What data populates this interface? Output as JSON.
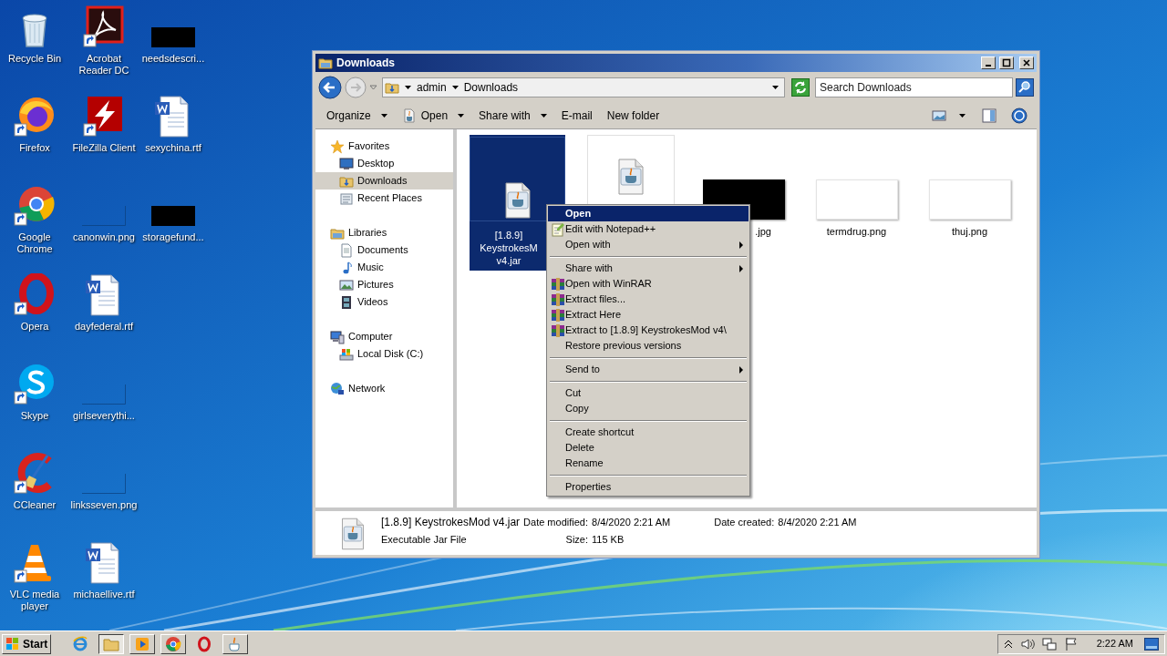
{
  "desktop": {
    "columns": [
      [
        {
          "label": "Recycle Bin",
          "kind": "recycle",
          "shortcut": false
        },
        {
          "label": "Firefox",
          "kind": "firefox",
          "shortcut": true
        },
        {
          "label": "Google Chrome",
          "kind": "chrome",
          "shortcut": true
        },
        {
          "label": "Opera",
          "kind": "opera",
          "shortcut": true
        },
        {
          "label": "Skype",
          "kind": "skype",
          "shortcut": true
        },
        {
          "label": "CCleaner",
          "kind": "ccleaner",
          "shortcut": true
        },
        {
          "label": "VLC media player",
          "kind": "vlc",
          "shortcut": true
        }
      ],
      [
        {
          "label": "Acrobat Reader DC",
          "kind": "acrobat",
          "shortcut": true
        },
        {
          "label": "FileZilla Client",
          "kind": "filezilla",
          "shortcut": true
        },
        {
          "label": "canonwin.png",
          "kind": "blank",
          "shortcut": false
        },
        {
          "label": "dayfederal.rtf",
          "kind": "word",
          "shortcut": false
        },
        {
          "label": "girlseverythi...",
          "kind": "blank",
          "shortcut": false
        },
        {
          "label": "linksseven.png",
          "kind": "blank",
          "shortcut": false
        },
        {
          "label": "michaellive.rtf",
          "kind": "word",
          "shortcut": false
        }
      ],
      [
        {
          "label": "needsdescri...",
          "kind": "black",
          "shortcut": false
        },
        {
          "label": "sexychina.rtf",
          "kind": "word",
          "shortcut": false
        },
        {
          "label": "storagefund...",
          "kind": "black",
          "shortcut": false
        }
      ]
    ]
  },
  "window": {
    "title": "Downloads",
    "breadcrumb": [
      "admin",
      "Downloads"
    ],
    "search": {
      "placeholder": "Search Downloads"
    },
    "toolbar": [
      {
        "label": "Organize",
        "dropdown": true,
        "kind": "plain"
      },
      {
        "label": "Open",
        "dropdown": true,
        "kind": "app"
      },
      {
        "label": "Share with",
        "dropdown": true,
        "kind": "plain"
      },
      {
        "label": "E-mail",
        "dropdown": false,
        "kind": "plain"
      },
      {
        "label": "New folder",
        "dropdown": false,
        "kind": "plain"
      }
    ],
    "nav": [
      {
        "label": "Favorites",
        "kind": "star",
        "selected": false,
        "children": [
          {
            "label": "Desktop",
            "kind": "desktop",
            "selected": false
          },
          {
            "label": "Downloads",
            "kind": "downloads",
            "selected": true
          },
          {
            "label": "Recent Places",
            "kind": "recent",
            "selected": false
          }
        ]
      },
      {
        "label": "Libraries",
        "kind": "libraries",
        "selected": false,
        "children": [
          {
            "label": "Documents",
            "kind": "documents",
            "selected": false
          },
          {
            "label": "Music",
            "kind": "music",
            "selected": false
          },
          {
            "label": "Pictures",
            "kind": "pictures",
            "selected": false
          },
          {
            "label": "Videos",
            "kind": "videos",
            "selected": false
          }
        ]
      },
      {
        "label": "Computer",
        "kind": "computer",
        "selected": false,
        "children": [
          {
            "label": "Local Disk (C:)",
            "kind": "disk",
            "selected": false
          }
        ]
      },
      {
        "label": "Network",
        "kind": "network",
        "selected": false
      }
    ],
    "files": [
      {
        "label": "[1.8.9] KeystrokesM v4.jar",
        "kind": "jar",
        "selected": true,
        "clipped_right": true,
        "clipped_left": false
      },
      {
        "kind": "jar_framed",
        "selected": false
      },
      {
        "label": ".jpg",
        "kind": "black",
        "selected": false,
        "clipped_right": false,
        "clipped_left": true
      },
      {
        "label": "termdrug.png",
        "kind": "white",
        "selected": false,
        "clipped_right": false,
        "clipped_left": false
      },
      {
        "label": "thuj.png",
        "kind": "white",
        "selected": false,
        "clipped_right": false,
        "clipped_left": false
      }
    ],
    "details": {
      "name": "[1.8.9] KeystrokesMod v4.jar",
      "type": "Executable Jar File",
      "properties": [
        {
          "label": "Date modified:",
          "value": "8/4/2020 2:21 AM"
        },
        {
          "label": "Date created:",
          "value": "8/4/2020 2:21 AM"
        },
        {
          "label": "Size:",
          "value": "115 KB"
        }
      ]
    }
  },
  "context_menu": [
    {
      "kind": "item",
      "label": "Open",
      "default": true,
      "selected": true,
      "submenu": false
    },
    {
      "kind": "notepad_item",
      "label": "Edit with Notepad++",
      "default": false,
      "selected": false,
      "submenu": false
    },
    {
      "kind": "item",
      "label": "Open with",
      "default": false,
      "selected": false,
      "submenu": true
    },
    {
      "kind": "separator"
    },
    {
      "kind": "item",
      "label": "Share with",
      "default": false,
      "selected": false,
      "submenu": true
    },
    {
      "kind": "archive_item",
      "label": "Open with WinRAR",
      "default": false,
      "selected": false,
      "submenu": false
    },
    {
      "kind": "archive_item",
      "label": "Extract files...",
      "default": false,
      "selected": false,
      "submenu": false
    },
    {
      "kind": "archive_item",
      "label": "Extract Here",
      "default": false,
      "selected": false,
      "submenu": false
    },
    {
      "kind": "archive_item",
      "label": "Extract to [1.8.9] KeystrokesMod v4\\",
      "default": false,
      "selected": false,
      "submenu": false
    },
    {
      "kind": "item",
      "label": "Restore previous versions",
      "default": false,
      "selected": false,
      "submenu": false
    },
    {
      "kind": "separator"
    },
    {
      "kind": "item",
      "label": "Send to",
      "default": false,
      "selected": false,
      "submenu": true
    },
    {
      "kind": "separator"
    },
    {
      "kind": "item",
      "label": "Cut",
      "default": false,
      "selected": false,
      "submenu": false
    },
    {
      "kind": "item",
      "label": "Copy",
      "default": false,
      "selected": false,
      "submenu": false
    },
    {
      "kind": "separator"
    },
    {
      "kind": "item",
      "label": "Create shortcut",
      "default": false,
      "selected": false,
      "submenu": false
    },
    {
      "kind": "item",
      "label": "Delete",
      "default": false,
      "selected": false,
      "submenu": false
    },
    {
      "kind": "item",
      "label": "Rename",
      "default": false,
      "selected": false,
      "submenu": false
    },
    {
      "kind": "separator"
    },
    {
      "kind": "item",
      "label": "Properties",
      "default": false,
      "selected": false,
      "submenu": false
    }
  ],
  "taskbar": {
    "start": "Start",
    "apps": [
      {
        "kind": "ie",
        "running": false,
        "selected": false
      },
      {
        "kind": "explorer",
        "running": true,
        "selected": true
      },
      {
        "kind": "media",
        "running": true,
        "selected": false
      },
      {
        "kind": "chrome",
        "running": true,
        "selected": false
      },
      {
        "kind": "opera",
        "running": false,
        "selected": false
      },
      {
        "kind": "java",
        "running": true,
        "selected": false
      }
    ],
    "clock": "2:22 AM"
  }
}
